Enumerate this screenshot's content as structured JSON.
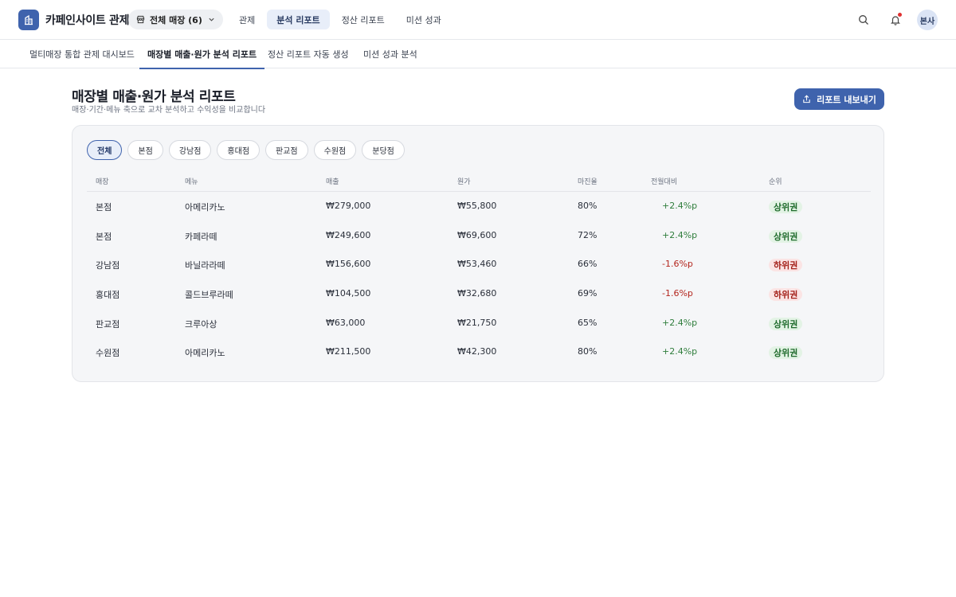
{
  "brand": {
    "name": "카페인사이트 관제"
  },
  "store_select": {
    "label": "전체 매장 (6)"
  },
  "top_nav": [
    {
      "label": "관제",
      "active": false
    },
    {
      "label": "분석 리포트",
      "active": true
    },
    {
      "label": "정산 리포트",
      "active": false
    },
    {
      "label": "미션 성과",
      "active": false
    }
  ],
  "user": {
    "avatar_label": "본사"
  },
  "subtabs": [
    {
      "label": "멀티매장 통합 관제 대시보드",
      "active": false
    },
    {
      "label": "매장별 매출·원가 분석 리포트",
      "active": true
    },
    {
      "label": "정산 리포트 자동 생성",
      "active": false
    },
    {
      "label": "미션 성과 분석",
      "active": false
    }
  ],
  "page": {
    "title": "매장별 매출·원가 분석 리포트",
    "subtitle": "매장·기간·메뉴 축으로 교차 분석하고 수익성을 비교합니다",
    "export_label": "리포트 내보내기"
  },
  "filters": [
    "전체",
    "본점",
    "강남점",
    "홍대점",
    "판교점",
    "수원점",
    "분당점"
  ],
  "active_filter": "전체",
  "table": {
    "columns": [
      "매장",
      "메뉴",
      "매출",
      "원가",
      "마진율",
      "전월대비",
      "순위"
    ],
    "rows": [
      {
        "store": "본점",
        "menu": "아메리카노",
        "sales": "₩279,000",
        "cost": "₩55,800",
        "margin": "80%",
        "mom": "+2.4%p",
        "rank": "상위권"
      },
      {
        "store": "본점",
        "menu": "카페라떼",
        "sales": "₩249,600",
        "cost": "₩69,600",
        "margin": "72%",
        "mom": "+2.4%p",
        "rank": "상위권"
      },
      {
        "store": "강남점",
        "menu": "바닐라라떼",
        "sales": "₩156,600",
        "cost": "₩53,460",
        "margin": "66%",
        "mom": "-1.6%p",
        "rank": "하위권"
      },
      {
        "store": "홍대점",
        "menu": "콜드브루라떼",
        "sales": "₩104,500",
        "cost": "₩32,680",
        "margin": "69%",
        "mom": "-1.6%p",
        "rank": "하위권"
      },
      {
        "store": "판교점",
        "menu": "크루아상",
        "sales": "₩63,000",
        "cost": "₩21,750",
        "margin": "65%",
        "mom": "+2.4%p",
        "rank": "상위권"
      },
      {
        "store": "수원점",
        "menu": "아메리카노",
        "sales": "₩211,500",
        "cost": "₩42,300",
        "margin": "80%",
        "mom": "+2.4%p",
        "rank": "상위권"
      }
    ]
  },
  "colors": {
    "accent": "#3f63ad",
    "positive": "#2f7d3c",
    "negative": "#b3261e"
  },
  "icons": {
    "brand": "store-building-icon",
    "store_select": "store-icon",
    "search": "search-icon",
    "notifications": "bell-icon",
    "export": "share-upload-icon"
  }
}
